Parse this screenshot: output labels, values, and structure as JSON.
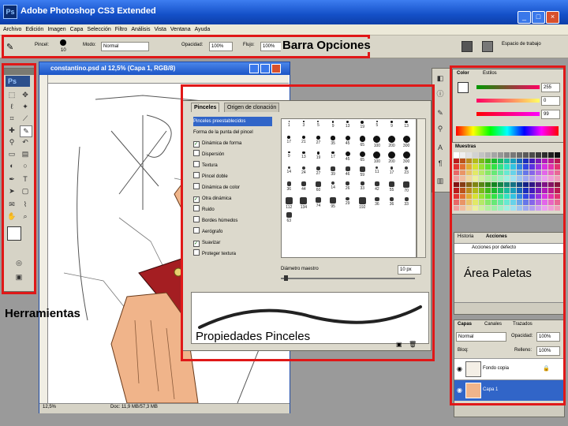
{
  "window": {
    "title": "Adobe Photoshop CS3 Extended",
    "app_badge": "Ps",
    "controls": [
      "_",
      "□",
      "×"
    ]
  },
  "menu": [
    "Archivo",
    "Edición",
    "Imagen",
    "Capa",
    "Selección",
    "Filtro",
    "Análisis",
    "Vista",
    "Ventana",
    "Ayuda"
  ],
  "options_bar": {
    "brush_label": "Pincel:",
    "brush_size": "10",
    "mode_label": "Modo:",
    "mode_value": "Normal",
    "opacity_label": "Opacidad:",
    "opacity_value": "100%",
    "flow_label": "Flujo:",
    "flow_value": "100%",
    "workspace_label": "Espacio de trabajo"
  },
  "toolbox": {
    "logo": "Ps"
  },
  "document": {
    "title": "constantino.psd al 12,5% (Capa 1, RGB/8)",
    "zoom": "12,5%",
    "doc_info": "Doc: 11,9 MB/57,3 MB"
  },
  "brushes_panel": {
    "tabs": [
      "Pinceles",
      "Origen de clonación"
    ],
    "options": [
      {
        "label": "Pinceles preestablecidos",
        "checked": null,
        "selected": true
      },
      {
        "label": "Forma de la punta del pincel",
        "checked": null,
        "selected": false
      },
      {
        "label": "Dinámica de forma",
        "checked": true,
        "selected": false
      },
      {
        "label": "Dispersión",
        "checked": false,
        "selected": false
      },
      {
        "label": "Textura",
        "checked": false,
        "selected": false
      },
      {
        "label": "Pincel doble",
        "checked": false,
        "selected": false
      },
      {
        "label": "Dinámica de color",
        "checked": false,
        "selected": false
      },
      {
        "label": "Otra dinámica",
        "checked": true,
        "selected": false
      },
      {
        "label": "Ruido",
        "checked": false,
        "selected": false
      },
      {
        "label": "Bordes húmedos",
        "checked": false,
        "selected": false
      },
      {
        "label": "Aerógrafo",
        "checked": false,
        "selected": false
      },
      {
        "label": "Suavizar",
        "checked": true,
        "selected": false
      },
      {
        "label": "Proteger textura",
        "checked": false,
        "selected": false
      }
    ],
    "tip_sizes": [
      "1",
      "3",
      "5",
      "9",
      "13",
      "19",
      "5",
      "9",
      "13",
      "17",
      "21",
      "27",
      "35",
      "45",
      "65",
      "100",
      "200",
      "300",
      "9",
      "13",
      "19",
      "17",
      "45",
      "65",
      "100",
      "200",
      "300",
      "14",
      "24",
      "27",
      "39",
      "46",
      "59",
      "11",
      "17",
      "23",
      "36",
      "44",
      "60",
      "14",
      "26",
      "33",
      "42",
      "55",
      "70",
      "112",
      "134",
      "74",
      "95",
      "29",
      "192",
      "36",
      "36",
      "33",
      "63"
    ],
    "diameter_label": "Diámetro maestro",
    "diameter_value": "10 px"
  },
  "color_panel": {
    "tabs": [
      "Color",
      "Estilos"
    ],
    "r": "255",
    "g": "0",
    "b": "99"
  },
  "swatches_panel": {
    "tab": "Muestras"
  },
  "history_panel": {
    "tabs": [
      "Historia",
      "Acciones"
    ],
    "item": "Acciones por defecto"
  },
  "layers_panel": {
    "tabs": [
      "Capas",
      "Canales",
      "Trazados"
    ],
    "blend": "Normal",
    "opacity_label": "Opacidad:",
    "opacity_value": "100%",
    "lock_label": "Bloq:",
    "fill_label": "Relleno:",
    "fill_value": "100%",
    "layers": [
      "Fondo copia",
      "Capa 1"
    ]
  },
  "annotations": {
    "options_bar": "Barra Opciones",
    "palettes": "Área Paletas",
    "tools": "Herramientas",
    "brush_props": "Propiedades Pinceles"
  },
  "colors": {
    "annotation_box": "#e01818",
    "xp_title": "#1450c8",
    "robe": "#a41e22",
    "skin": "#f0b48a",
    "selected_layer": "#3165c8"
  }
}
